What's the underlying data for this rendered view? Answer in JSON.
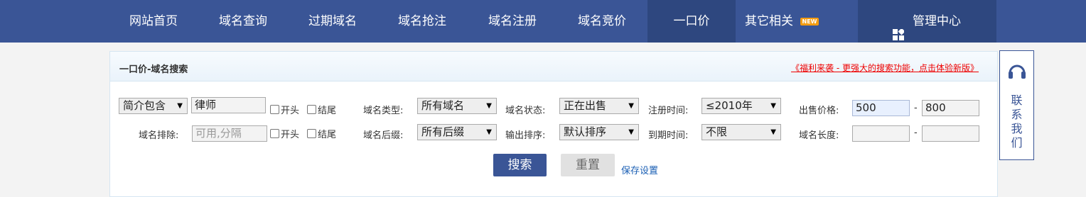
{
  "nav": {
    "items": [
      {
        "label": "网站首页"
      },
      {
        "label": "域名查询"
      },
      {
        "label": "过期域名"
      },
      {
        "label": "域名抢注"
      },
      {
        "label": "域名注册"
      },
      {
        "label": "域名竞价"
      },
      {
        "label": "一口价",
        "active": true
      },
      {
        "label": "其它相关"
      }
    ],
    "new_badge": "NEW",
    "admin_label": "管理中心"
  },
  "panel": {
    "title": "一口价-域名搜索",
    "promo_link": "《福利来袭 - 更强大的搜索功能，点击体验新版》"
  },
  "search": {
    "row1": {
      "match_select": "简介包含",
      "keyword_value": "律师",
      "start_label": "开头",
      "end_label": "结尾",
      "type_label": "域名类型:",
      "type_value": "所有域名",
      "status_label": "域名状态:",
      "status_value": "正在出售",
      "regtime_label": "注册时间:",
      "regtime_value": "≤2010年",
      "price_label": "出售价格:",
      "price_min": "500",
      "price_sep": "-",
      "price_max": "800"
    },
    "row2": {
      "exclude_label": "域名排除:",
      "exclude_placeholder": "可用,分隔",
      "start_label": "开头",
      "end_label": "结尾",
      "suffix_label": "域名后缀:",
      "suffix_value": "所有后缀",
      "sort_label": "输出排序:",
      "sort_value": "默认排序",
      "expire_label": "到期时间:",
      "expire_value": "不限",
      "length_label": "域名长度:",
      "length_min": "",
      "length_sep": "-",
      "length_max": ""
    },
    "search_button": "搜索",
    "reset_button": "重置",
    "save_link": "保存设置"
  },
  "contact": {
    "label": "联系我们",
    "chars": [
      "联",
      "系",
      "我",
      "们"
    ]
  },
  "colors": {
    "nav_bg": "#3a5596",
    "nav_active": "#2e477f",
    "promo": "#e00000",
    "badge": "#f39c12"
  }
}
